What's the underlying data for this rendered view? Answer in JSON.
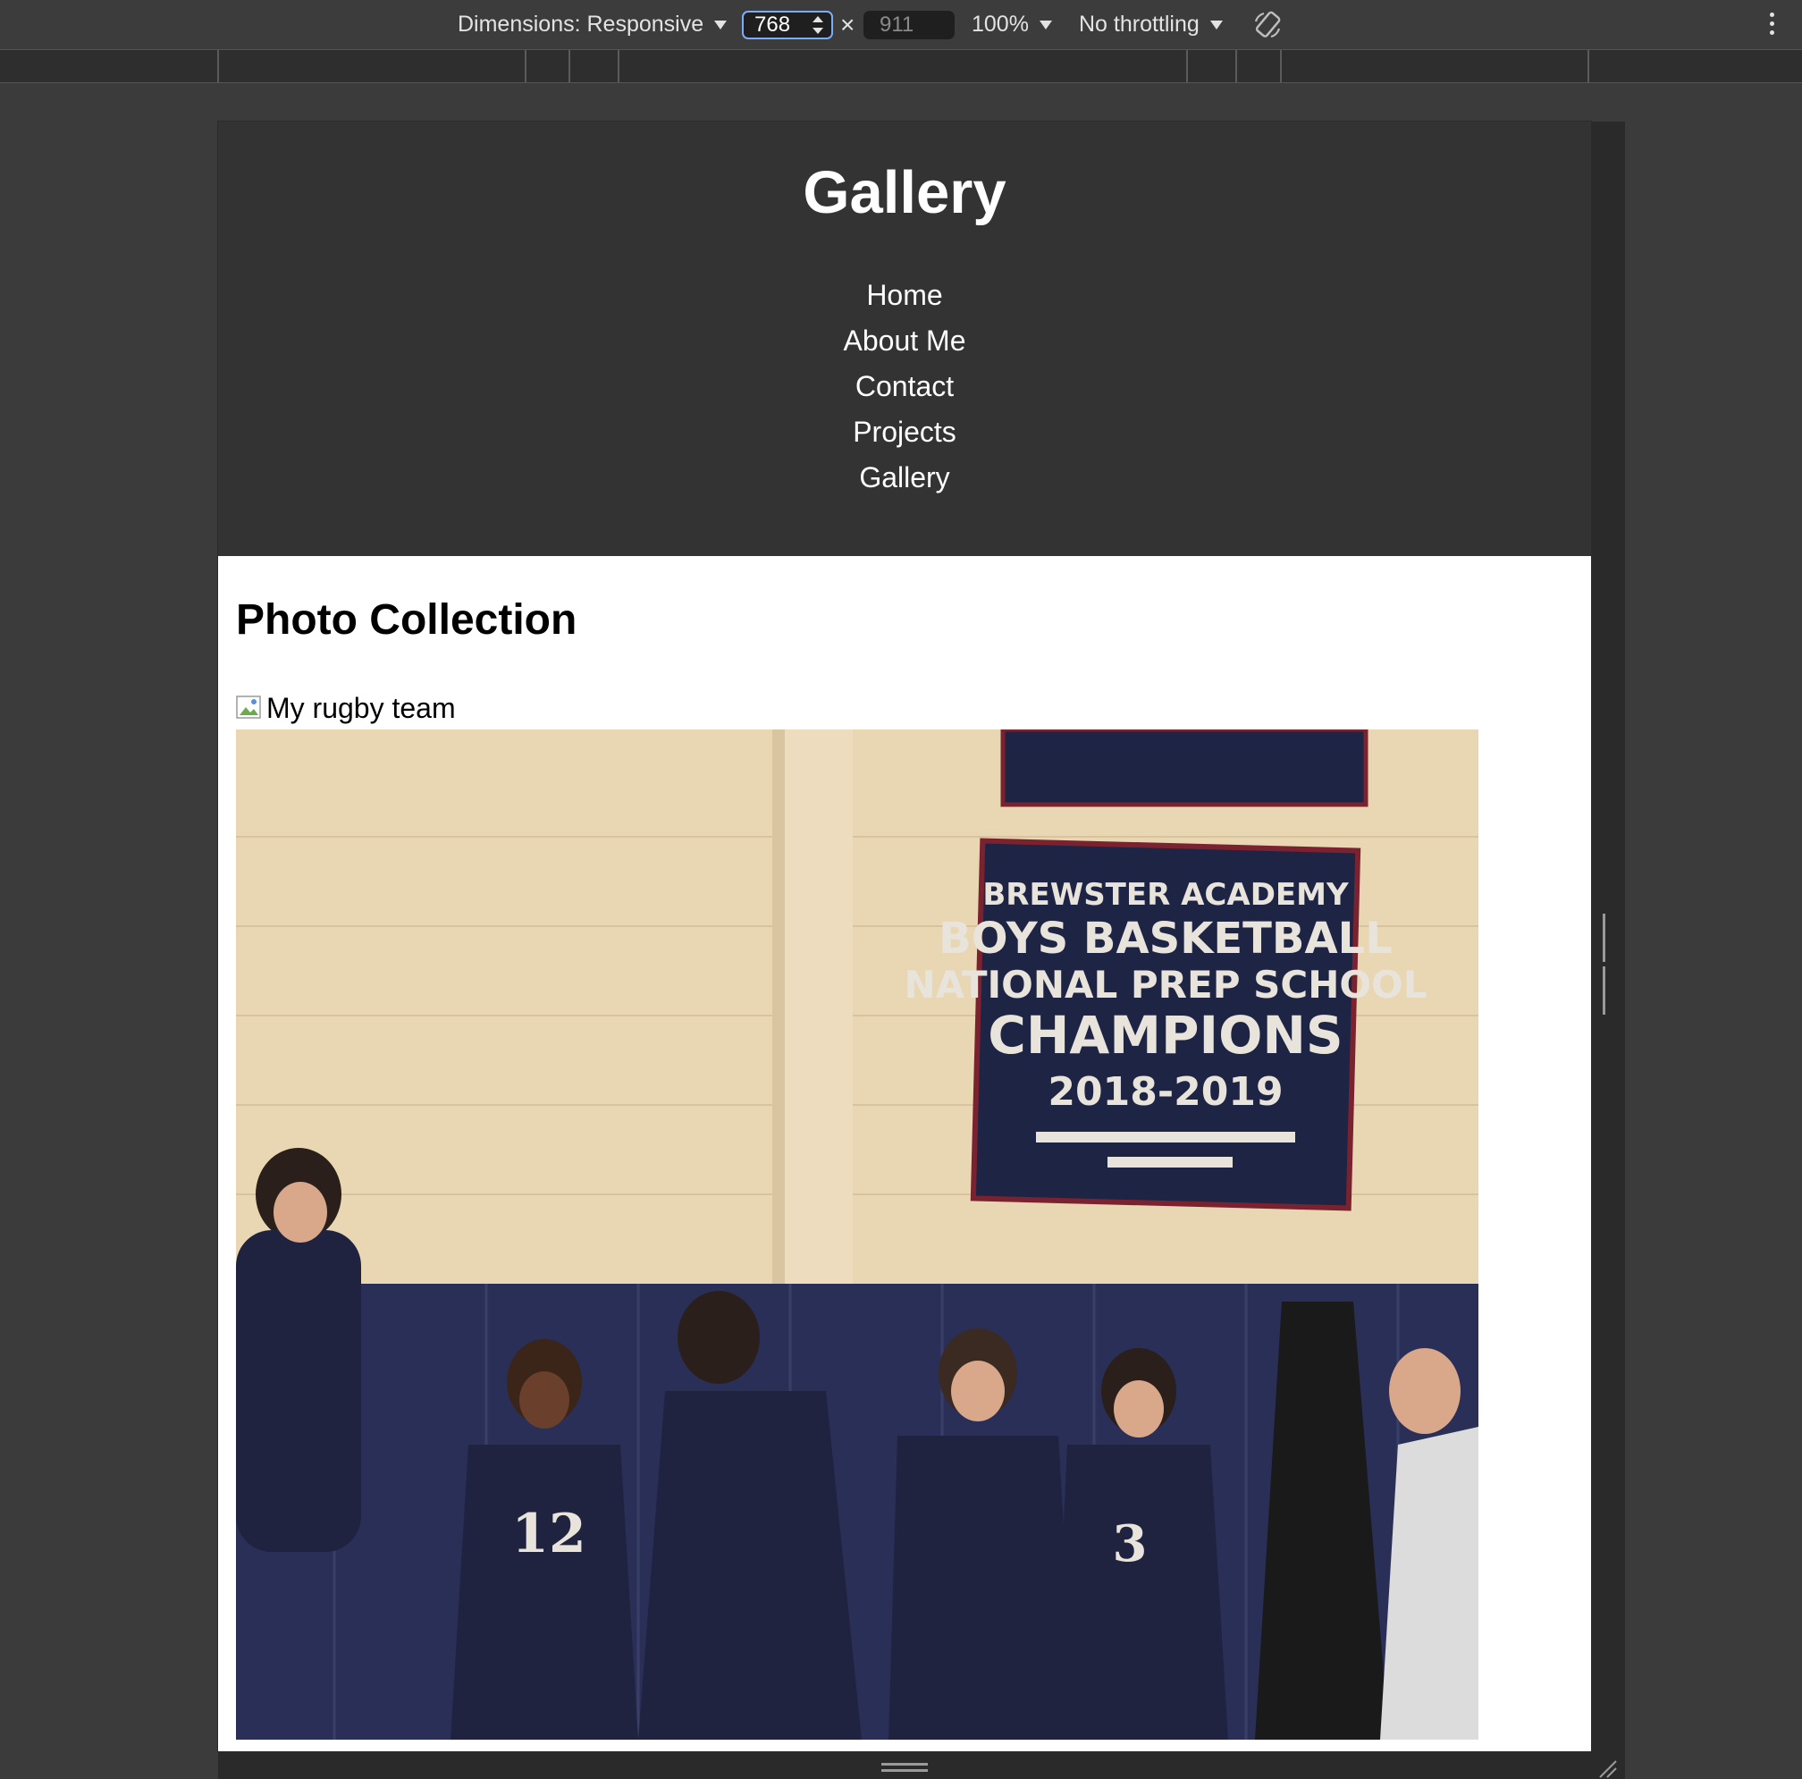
{
  "devtools": {
    "dimensions_label": "Dimensions: Responsive",
    "width_value": "768",
    "times": "×",
    "height_placeholder": "911",
    "zoom": "100%",
    "throttling": "No throttling"
  },
  "site": {
    "title": "Gallery",
    "nav": [
      "Home",
      "About Me",
      "Contact",
      "Projects",
      "Gallery"
    ],
    "section_title": "Photo Collection",
    "broken_image_alt": "My rugby team",
    "banner": {
      "line1": "BREWSTER ACADEMY",
      "line2": "BOYS BASKETBALL",
      "line3": "NATIONAL PREP SCHOOL",
      "line4": "CHAMPIONS",
      "line5": "2018-2019"
    },
    "jerseys": [
      "12",
      "3"
    ]
  },
  "colors": {
    "toolbar_bg": "#3c3c3c",
    "header_bg": "#333333",
    "focus_ring": "#7cacf8",
    "banner_navy": "#1e2444",
    "wall": "#e6d2ad"
  }
}
